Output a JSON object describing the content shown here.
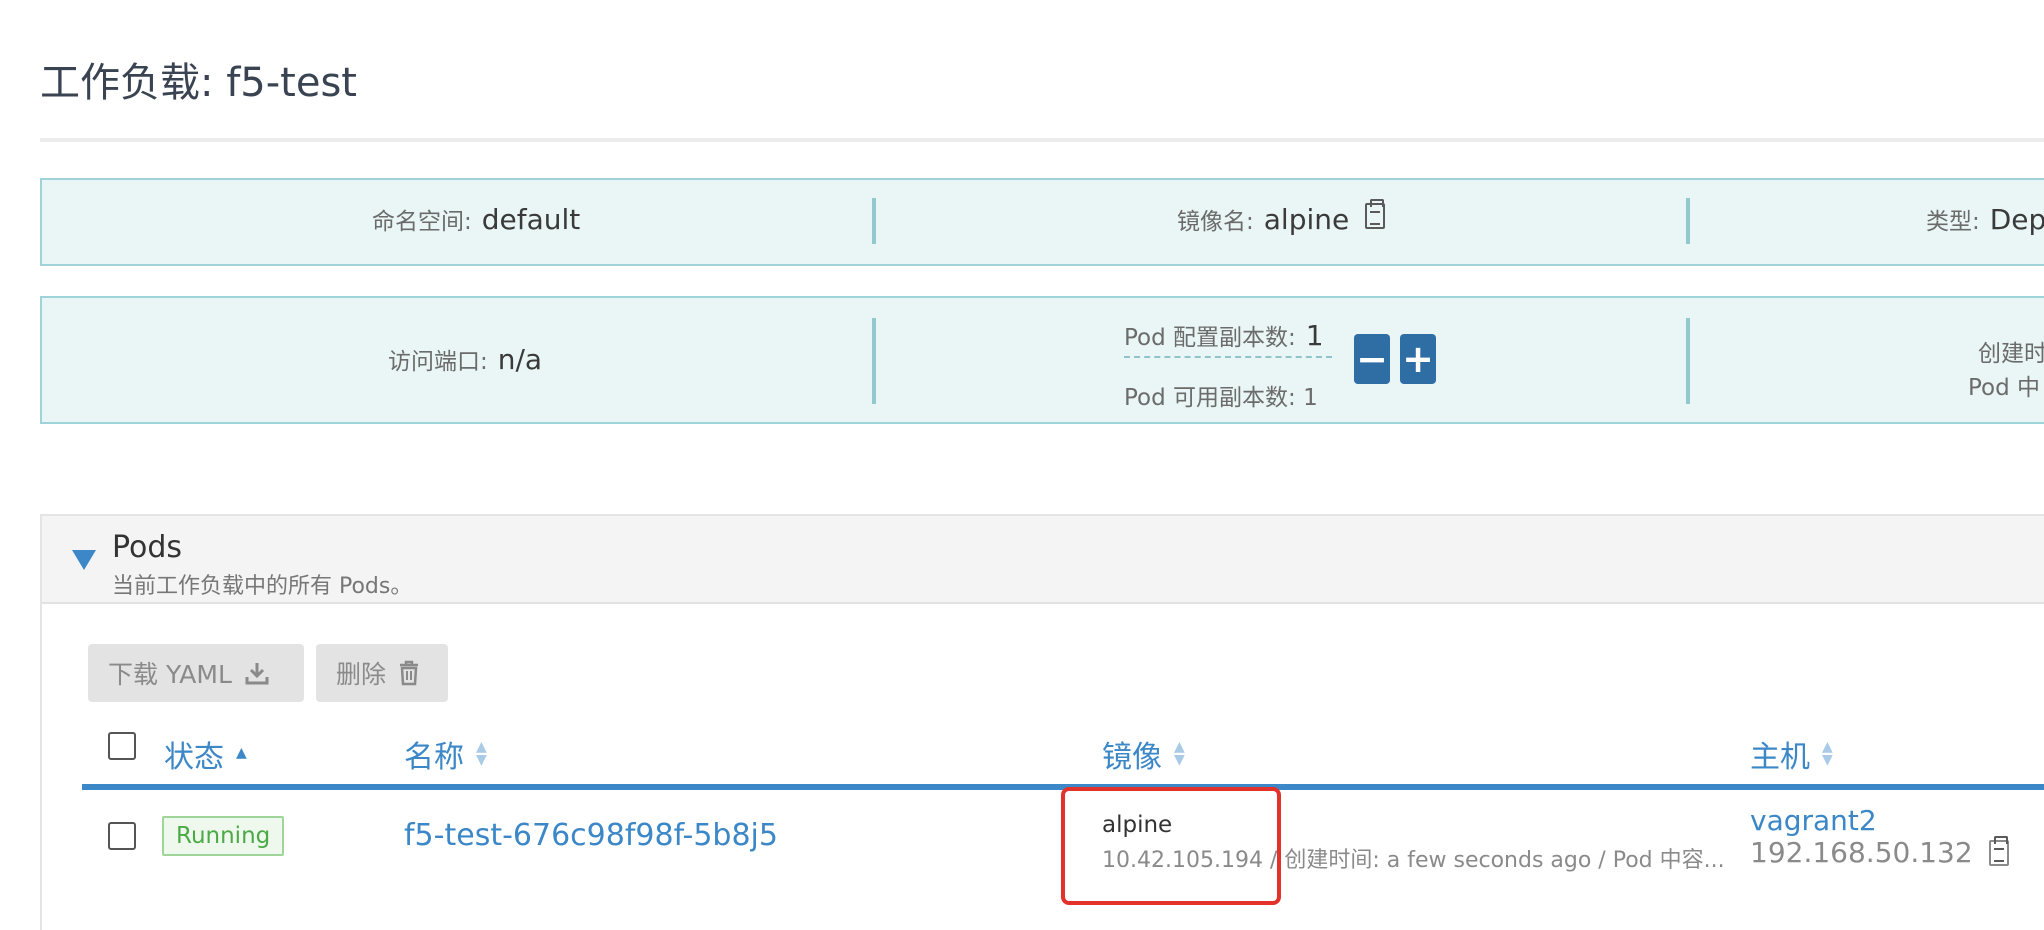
{
  "page": {
    "title": "工作负载: f5-test"
  },
  "info_row1": {
    "namespace_label": "命名空间:",
    "namespace_value": "default",
    "image_label": "镜像名:",
    "image_value": "alpine",
    "type_label": "类型:",
    "type_value": "Dep"
  },
  "info_row2": {
    "port_label": "访问端口:",
    "port_value": "n/a",
    "desired_label": "Pod 配置副本数:",
    "desired_value": "1",
    "available_label": "Pod 可用副本数: 1",
    "decrement": "−",
    "increment": "+",
    "created_label": "创建时",
    "pod_label": "Pod 中"
  },
  "pods": {
    "title": "Pods",
    "subtitle": "当前工作负载中的所有 Pods。",
    "download_label": "下载 YAML",
    "delete_label": "删除",
    "columns": {
      "state": "状态",
      "name": "名称",
      "image": "镜像",
      "node": "主机"
    },
    "rows": [
      {
        "state": "Running",
        "name": "f5-test-676c98f98f-5b8j5",
        "image": "alpine",
        "detail": "10.42.105.194 / 创建时间: a few seconds ago / Pod 中容...",
        "node": "vagrant2",
        "node_ip": "192.168.50.132"
      }
    ]
  },
  "colors": {
    "accent": "#3b87c7",
    "info_bg": "#eaf6f6",
    "running": "#4caa46",
    "highlight": "#e2322a"
  }
}
